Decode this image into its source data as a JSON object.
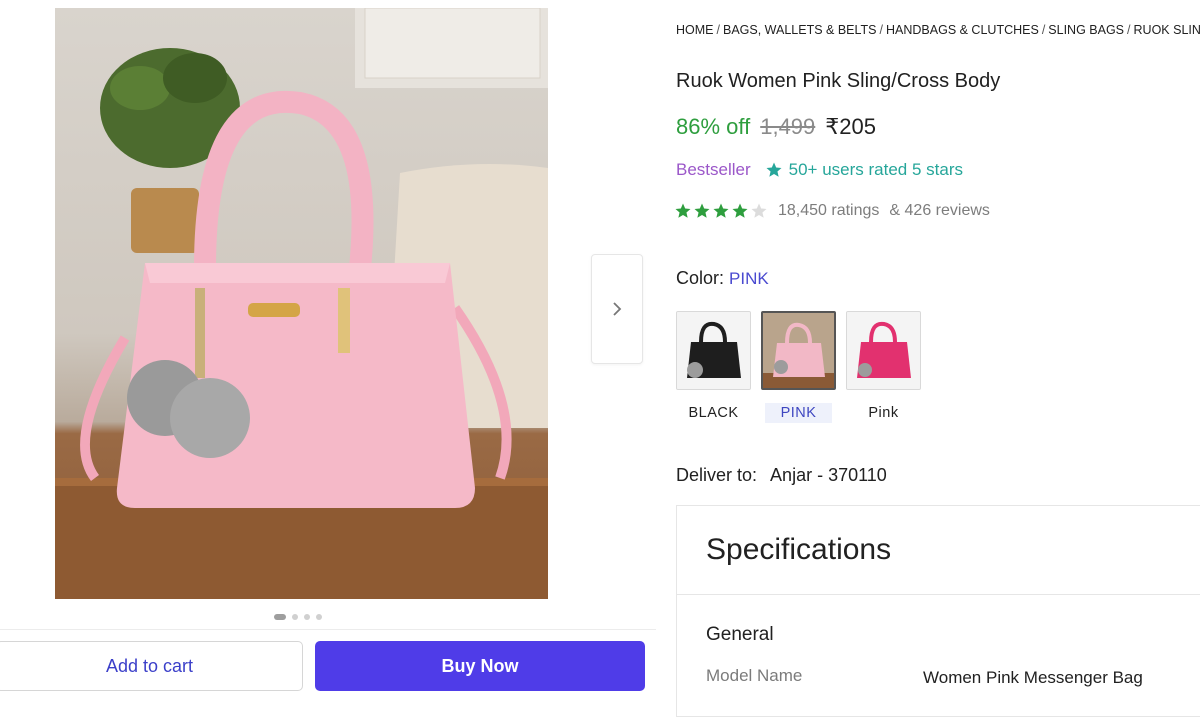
{
  "breadcrumb": [
    "HOME",
    "BAGS, WALLETS & BELTS",
    "HANDBAGS & CLUTCHES",
    "SLING BAGS",
    "RUOK SLING"
  ],
  "product": {
    "title": "Ruok Women Pink Sling/Cross Body",
    "discount": "86% off",
    "mrp": "1,499",
    "price": "₹205",
    "bestseller": "Bestseller",
    "rated_badge": "50+ users rated 5 stars",
    "rating_stars": 4,
    "ratings_count": "18,450 ratings",
    "reviews_count": "& 426 reviews"
  },
  "color": {
    "label": "Color:",
    "selected": "PINK",
    "options": [
      {
        "label": "BLACK",
        "swatch": "#1e1e1e"
      },
      {
        "label": "PINK",
        "swatch": "#f2b8c6"
      },
      {
        "label": "Pink",
        "swatch": "#e2316f"
      }
    ]
  },
  "deliver": {
    "label": "Deliver to:",
    "location": "Anjar - 370110"
  },
  "specifications": {
    "heading": "Specifications",
    "section": "General",
    "rows": [
      {
        "key": "Model Name",
        "value": "Women Pink Messenger Bag"
      }
    ]
  },
  "actions": {
    "add_to_cart": "Add to cart",
    "buy_now": "Buy Now"
  },
  "gallery": {
    "total_images": 4,
    "active_index": 0
  },
  "colors": {
    "accent": "#4f3ce8",
    "discount": "#2e9e3e",
    "bestseller": "#9b57c9",
    "rated": "#26a69a",
    "star": "#2e9e3e"
  }
}
